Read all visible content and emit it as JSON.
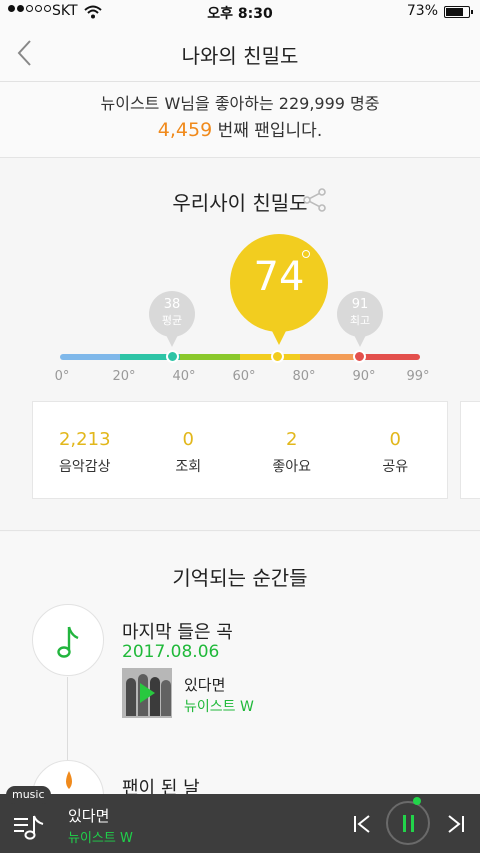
{
  "status": {
    "carrier": "SKT",
    "time": "오후 8:30",
    "battery": "73%"
  },
  "nav": {
    "title": "나와의 친밀도"
  },
  "fan": {
    "line1": "뉴이스트 W님을 좋아하는 229,999 명중",
    "rank": "4,459",
    "rank_suffix": " 번째 팬입니다."
  },
  "intimacy": {
    "title": "우리사이 친밀도",
    "score": "74",
    "average": {
      "value": "38",
      "label": "평균"
    },
    "max": {
      "value": "91",
      "label": "최고"
    },
    "ticks": [
      "0°",
      "20°",
      "40°",
      "60°",
      "80°",
      "90°",
      "99°"
    ],
    "gauge_colors": [
      "#7fb8ea",
      "#2ec4a6",
      "#8ac82c",
      "#f2cd1f",
      "#f39c56",
      "#e3504c"
    ],
    "stats": [
      {
        "value": "2,213",
        "label": "음악감상"
      },
      {
        "value": "0",
        "label": "조회"
      },
      {
        "value": "2",
        "label": "좋아요"
      },
      {
        "value": "0",
        "label": "공유"
      }
    ]
  },
  "memories": {
    "title": "기억되는 순간들",
    "last_song": {
      "title": "마지막 들은 곡",
      "date": "2017.08.06",
      "song": "있다면",
      "artist": "뉴이스트 W"
    },
    "fan_day": {
      "title": "팬이 된 날"
    }
  },
  "player": {
    "badge": "music",
    "song": "있다면",
    "artist": "뉴이스트 W"
  }
}
